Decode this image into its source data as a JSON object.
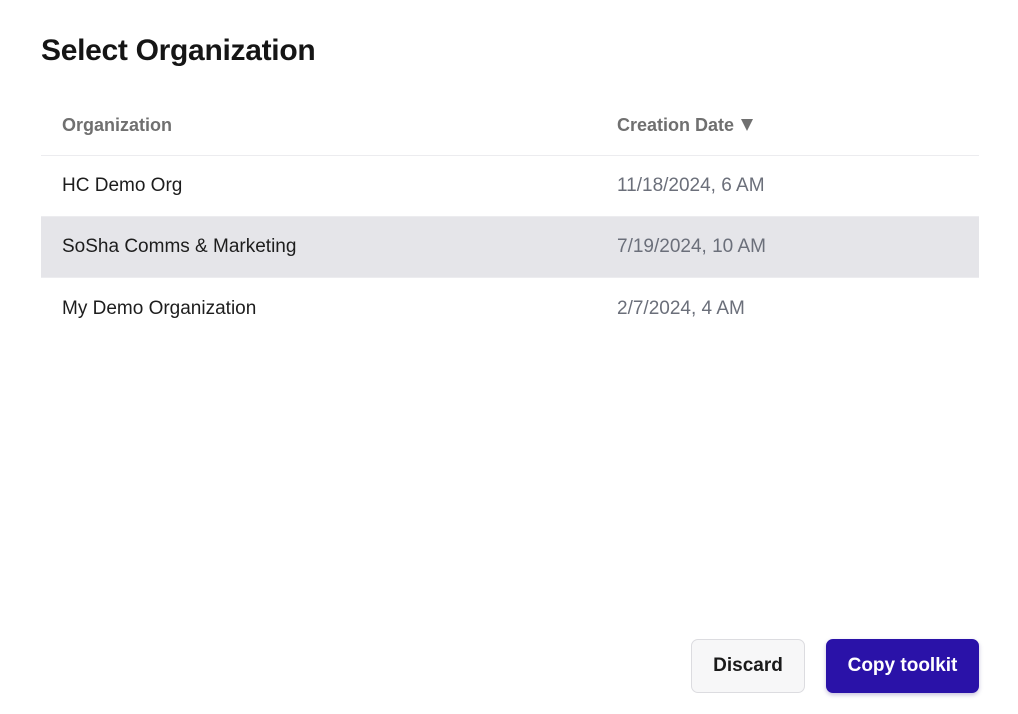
{
  "dialog": {
    "title": "Select Organization"
  },
  "table": {
    "columns": {
      "organization": "Organization",
      "creation_date": "Creation Date",
      "sort_icon": "sort-descending-icon"
    },
    "rows": [
      {
        "organization": "HC Demo Org",
        "creation_date": "11/18/2024, 6 AM",
        "selected": false
      },
      {
        "organization": "SoSha Comms & Marketing",
        "creation_date": "7/19/2024, 10 AM",
        "selected": true
      },
      {
        "organization": "My Demo Organization",
        "creation_date": "2/7/2024, 4 AM",
        "selected": false
      }
    ]
  },
  "actions": {
    "discard_label": "Discard",
    "copy_label": "Copy toolkit"
  },
  "colors": {
    "primary": "#2a12a8",
    "selected_row": "#e5e5e9"
  }
}
